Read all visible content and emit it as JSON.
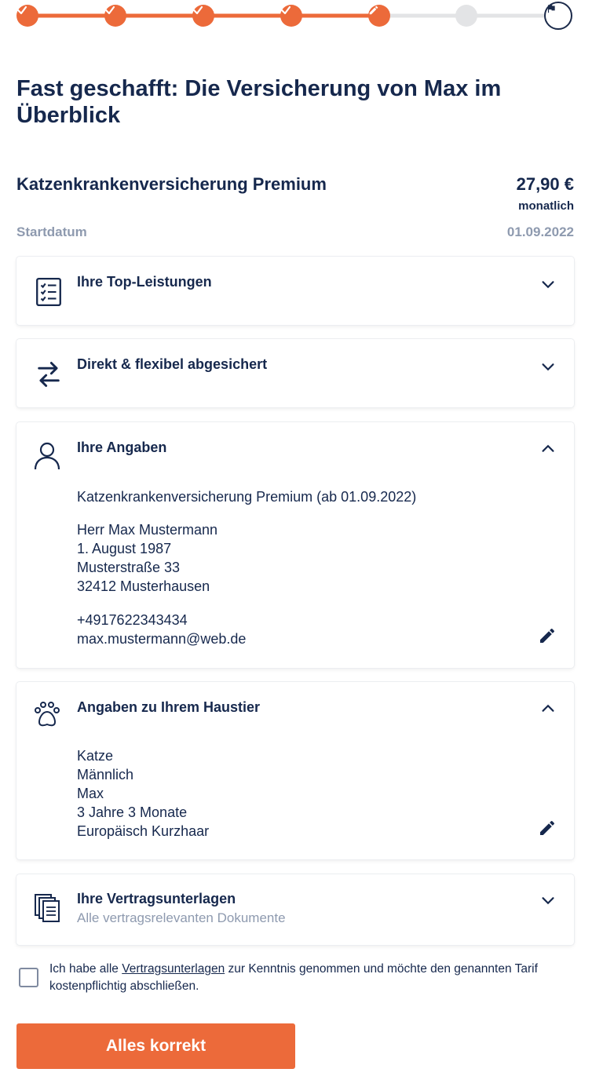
{
  "progress": {
    "steps": [
      "done",
      "done",
      "done",
      "done",
      "current",
      "todo",
      "final"
    ],
    "accent_color": "#ec6a3a",
    "icons": {
      "done": "check-icon",
      "current": "pencil-icon",
      "final": "flag-icon"
    }
  },
  "page_title": "Fast geschafft: Die Versicherung von Max im Überblick",
  "summary": {
    "product_name": "Katzenkrankenversicherung Premium",
    "price": "27,90 €",
    "price_period": "monatlich",
    "start_label": "Startdatum",
    "start_value": "01.09.2022"
  },
  "cards": {
    "top_benefits": {
      "title": "Ihre Top-Leistungen",
      "icon": "checklist-icon"
    },
    "flexible": {
      "title": "Direkt & flexibel abgesichert",
      "icon": "swap-arrows-icon"
    },
    "your_details": {
      "title": "Ihre Angaben",
      "icon": "person-icon",
      "product_line": "Katzenkrankenversicherung Premium (ab 01.09.2022)",
      "name": "Herr Max Mustermann",
      "birthdate": "1. August 1987",
      "street": "Musterstraße 33",
      "city": "32412 Musterhausen",
      "phone": "+4917622343434",
      "email": "max.mustermann@web.de"
    },
    "pet_details": {
      "title": "Angaben zu Ihrem Haustier",
      "icon": "paw-icon",
      "species": "Katze",
      "sex": "Männlich",
      "name": "Max",
      "age": "3 Jahre 3 Monate",
      "breed": "Europäisch Kurzhaar"
    },
    "documents": {
      "title": "Ihre Vertragsunterlagen",
      "subtitle": "Alle vertragsrelevanten Dokumente",
      "icon": "documents-icon"
    }
  },
  "consent": {
    "text_before": "Ich habe alle ",
    "link_text": "Vertragsunterlagen",
    "text_after": " zur Kenntnis genommen und möchte den genannten Tarif kostenpflichtig abschließen.",
    "checked": false
  },
  "cta_label": "Alles korrekt"
}
